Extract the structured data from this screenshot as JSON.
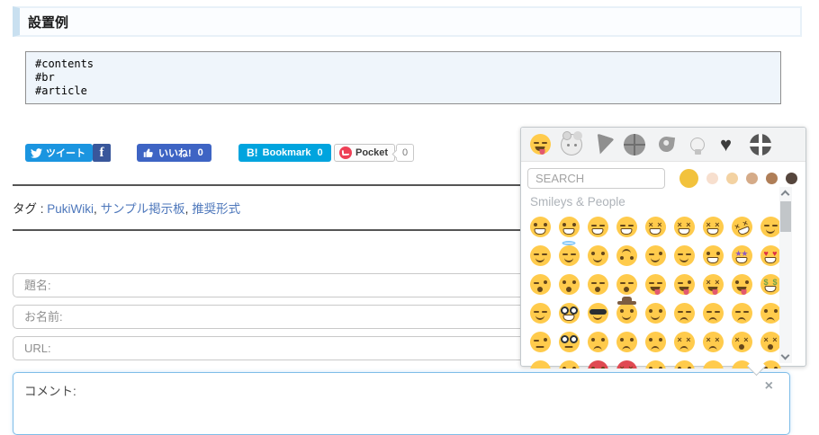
{
  "header": {
    "title": "設置例"
  },
  "code_block": {
    "text": "#contents\n#br\n#article"
  },
  "share": {
    "tweet_label": "ツイート",
    "facebook_label": "f",
    "like_label": "いいね!",
    "like_count": "0",
    "hatena_label": "B!",
    "hatena_text": "Bookmark",
    "hatena_count": "0",
    "pocket_label": "Pocket",
    "pocket_count": "0"
  },
  "tags": {
    "label": "タグ :",
    "items": [
      "PukiWiki",
      "サンプル掲示板",
      "推奨形式"
    ]
  },
  "form": {
    "subject_placeholder": "題名:",
    "name_placeholder": "お名前:",
    "url_placeholder": "URL:",
    "comment_placeholder": "コメント:",
    "picker_close_icon": "×"
  },
  "picker": {
    "search_placeholder": "SEARCH",
    "section_title": "Smileys & People",
    "categories": [
      {
        "name": "smileys-people",
        "active": true
      },
      {
        "name": "animals-nature",
        "active": false
      },
      {
        "name": "food-drink",
        "active": false
      },
      {
        "name": "activity",
        "active": false
      },
      {
        "name": "travel-places",
        "active": false
      },
      {
        "name": "objects",
        "active": false
      },
      {
        "name": "symbols",
        "active": false
      },
      {
        "name": "flags",
        "active": false
      }
    ],
    "skin_tones": [
      "#f2c23c",
      "#f7dfce",
      "#f3d2a2",
      "#d5ab88",
      "#af7e57",
      "#55453c"
    ],
    "emoji_rows": [
      [
        {
          "n": "grinning-face",
          "ch": "😀",
          "e": "dot",
          "m": "grin"
        },
        {
          "n": "grinning-face-big-eyes",
          "ch": "😃",
          "e": "dot",
          "m": "grin"
        },
        {
          "n": "grinning-face-smiling-eyes",
          "ch": "😄",
          "e": "ln",
          "m": "grin"
        },
        {
          "n": "beaming-face",
          "ch": "😁",
          "e": "ln",
          "m": "grin"
        },
        {
          "n": "grinning-squinting-face",
          "ch": "😆",
          "e": "x",
          "m": "grin"
        },
        {
          "n": "grinning-face-with-sweat",
          "ch": "😅",
          "e": "x",
          "m": "grin"
        },
        {
          "n": "face-with-tears-of-joy",
          "ch": "😂",
          "e": "x",
          "m": "grin"
        },
        {
          "n": "rolling-on-floor-laughing",
          "ch": "🤣",
          "e": "x",
          "m": "grin",
          "t": "tilt"
        },
        {
          "n": "smiling-face-blush",
          "ch": "😊",
          "e": "ln",
          "m": "smile"
        }
      ],
      [
        {
          "n": "relaxed-smiling-face",
          "ch": "☺",
          "e": "ln",
          "m": "smile"
        },
        {
          "n": "smiling-face-with-halo",
          "ch": "😇",
          "e": "ln",
          "m": "smile",
          "a": "halo"
        },
        {
          "n": "slightly-smiling-face",
          "ch": "🙂",
          "e": "dot",
          "m": "smile"
        },
        {
          "n": "upside-down-face",
          "ch": "🙃",
          "e": "dot",
          "m": "smile",
          "t": "flip"
        },
        {
          "n": "winking-face",
          "ch": "😉",
          "e": "wink",
          "m": "smile"
        },
        {
          "n": "relieved-face",
          "ch": "😌",
          "e": "ln",
          "m": "smile"
        },
        {
          "n": "zany-face",
          "ch": "🤪",
          "e": "dot",
          "m": "grin"
        },
        {
          "n": "star-struck",
          "ch": "🤩",
          "e": "star",
          "m": "grin"
        },
        {
          "n": "heart-eyes",
          "ch": "😍",
          "e": "heart",
          "m": "grin"
        }
      ],
      [
        {
          "n": "face-blowing-kiss",
          "ch": "😘",
          "e": "wink",
          "m": "open"
        },
        {
          "n": "kissing-face",
          "ch": "😗",
          "e": "dot",
          "m": "open"
        },
        {
          "n": "kissing-closed-eyes",
          "ch": "😚",
          "e": "ln",
          "m": "open"
        },
        {
          "n": "kissing-smiling-eyes",
          "ch": "😙",
          "e": "ln",
          "m": "open"
        },
        {
          "n": "yum-face",
          "ch": "😋",
          "e": "ln",
          "m": "tongue"
        },
        {
          "n": "winking-tongue-face",
          "ch": "😜",
          "e": "wink",
          "m": "tongue"
        },
        {
          "n": "squinting-tongue-face",
          "ch": "😝",
          "e": "x",
          "m": "tongue"
        },
        {
          "n": "tongue-out-face",
          "ch": "😛",
          "e": "dot",
          "m": "tongue"
        },
        {
          "n": "money-mouth-face",
          "ch": "🤑",
          "e": "money",
          "m": "grin"
        }
      ],
      [
        {
          "n": "hugging-face",
          "ch": "🤗",
          "e": "ln",
          "m": "smile"
        },
        {
          "n": "nerd-face",
          "ch": "🤓",
          "e": "gl",
          "m": "grin"
        },
        {
          "n": "sunglasses-face",
          "ch": "😎",
          "e": "sun",
          "m": "smile"
        },
        {
          "n": "cowboy-face",
          "ch": "🤠",
          "e": "dot",
          "m": "smile",
          "a": "hat"
        },
        {
          "n": "smirking-face",
          "ch": "😏",
          "e": "dot",
          "m": "smile"
        },
        {
          "n": "unamused-face",
          "ch": "😒",
          "e": "ln",
          "m": "frown"
        },
        {
          "n": "disappointed-face",
          "ch": "😞",
          "e": "ln",
          "m": "frown"
        },
        {
          "n": "pensive-face",
          "ch": "😔",
          "e": "ln",
          "m": "frown"
        },
        {
          "n": "worried-face",
          "ch": "😟",
          "e": "dot",
          "m": "frown"
        }
      ],
      [
        {
          "n": "face-raised-eyebrow",
          "ch": "🤨",
          "e": "wink",
          "m": "flat"
        },
        {
          "n": "monocle-face",
          "ch": "🧐",
          "e": "gl",
          "m": "flat"
        },
        {
          "n": "confused-face",
          "ch": "😕",
          "e": "dot",
          "m": "frown"
        },
        {
          "n": "slightly-frowning-face",
          "ch": "🙁",
          "e": "dot",
          "m": "frown"
        },
        {
          "n": "frowning-face",
          "ch": "☹",
          "e": "dot",
          "m": "frown"
        },
        {
          "n": "persevering-face",
          "ch": "😣",
          "e": "x",
          "m": "frown"
        },
        {
          "n": "confounded-face",
          "ch": "😖",
          "e": "x",
          "m": "frown"
        },
        {
          "n": "tired-face",
          "ch": "😫",
          "e": "x",
          "m": "open"
        },
        {
          "n": "weary-face",
          "ch": "😩",
          "e": "x",
          "m": "open"
        }
      ],
      [
        {
          "n": "face-with-steam",
          "ch": "😤",
          "e": "ln",
          "m": "frown"
        },
        {
          "n": "angry-face",
          "ch": "😠",
          "e": "dot",
          "m": "frown"
        },
        {
          "n": "pouting-face",
          "ch": "😡",
          "e": "dot",
          "m": "frown",
          "c": "#e04a52"
        },
        {
          "n": "cursing-face",
          "ch": "🤬",
          "e": "x",
          "m": "flat",
          "c": "#e04a52"
        },
        {
          "n": "face-without-mouth",
          "ch": "😶",
          "e": "dot",
          "m": "flat"
        },
        {
          "n": "neutral-face",
          "ch": "😐",
          "e": "dot",
          "m": "flat"
        },
        {
          "n": "expressionless-face",
          "ch": "😑",
          "e": "ln",
          "m": "flat"
        },
        {
          "n": "hand-over-mouth-face",
          "ch": "🤭",
          "e": "ln",
          "m": "smile"
        },
        {
          "n": "grimacing-face",
          "ch": "😬",
          "e": "dot",
          "m": "grin"
        }
      ]
    ]
  }
}
